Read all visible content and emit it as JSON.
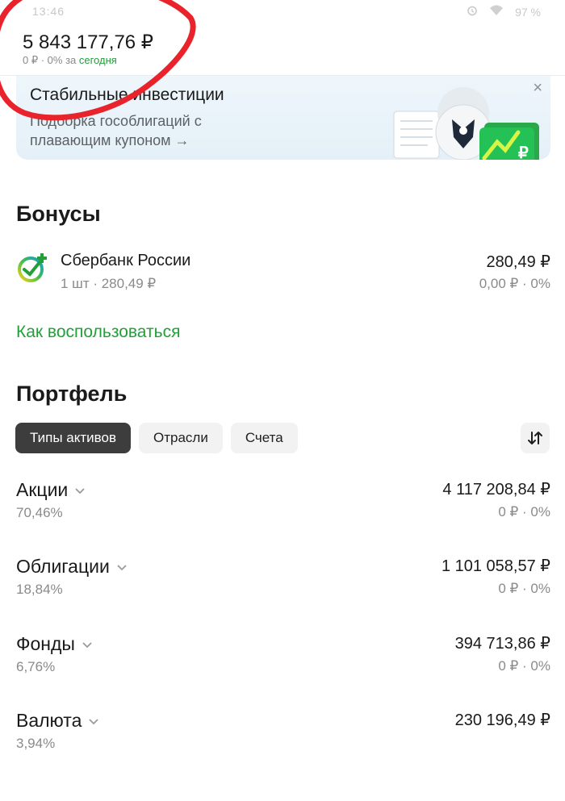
{
  "status_bar": {
    "time": "13:46",
    "battery": "97 %",
    "wifi_icon": "wifi-icon",
    "alarm_icon": "alarm-icon"
  },
  "header": {
    "total_value": "5 843 177,76 ₽",
    "change_prefix": "0 ₽ · 0% за ",
    "change_period": "сегодня"
  },
  "banner": {
    "title": "Стабильные инвестиции",
    "subtitle": "Подборка гособлигаций с плавающим купоном →",
    "close_label": "×"
  },
  "bonuses": {
    "title": "Бонусы",
    "item": {
      "name": "Сбербанк России",
      "qty": "1 шт · 280,49 ₽",
      "value": "280,49 ₽",
      "change": "0,00 ₽ · 0%"
    },
    "link": "Как воспользоваться"
  },
  "portfolio": {
    "title": "Портфель",
    "tabs": [
      {
        "label": "Типы активов",
        "active": true
      },
      {
        "label": "Отрасли",
        "active": false
      },
      {
        "label": "Счета",
        "active": false
      }
    ],
    "assets": [
      {
        "name": "Акции",
        "share": "70,46%",
        "value": "4 117 208,84 ₽",
        "change": "0 ₽ · 0%"
      },
      {
        "name": "Облигации",
        "share": "18,84%",
        "value": "1 101 058,57 ₽",
        "change": "0 ₽ · 0%"
      },
      {
        "name": "Фонды",
        "share": "6,76%",
        "value": "394 713,86 ₽",
        "change": "0 ₽ · 0%"
      },
      {
        "name": "Валюта",
        "share": "3,94%",
        "value": "230 196,49 ₽",
        "change": ""
      }
    ]
  },
  "colors": {
    "accent_green": "#21a038",
    "annotation_red": "#e8232b",
    "active_tab": "#3d3d3d"
  }
}
